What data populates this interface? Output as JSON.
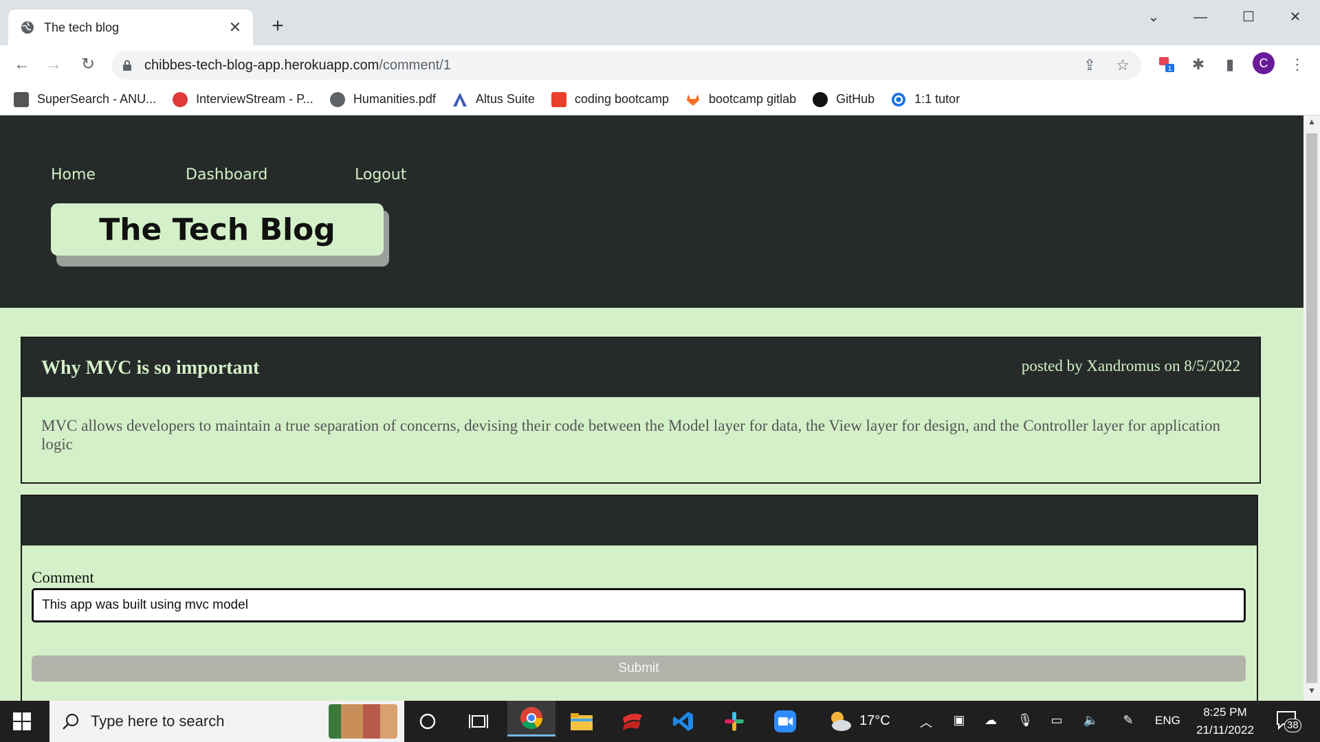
{
  "browser": {
    "tab_title": "The tech blog",
    "url_host": "chibbes-tech-blog-app.herokuapp.com",
    "url_path": "/comment/1",
    "profile_initial": "C",
    "extension_badge": "1"
  },
  "bookmarks": [
    {
      "label": "SuperSearch - ANU...",
      "icon": "supersearch-icon",
      "color": "#555555"
    },
    {
      "label": "InterviewStream - P...",
      "icon": "interviewstream-icon",
      "color": "#e03a3a"
    },
    {
      "label": "Humanities.pdf",
      "icon": "globe-icon",
      "color": "#5f6368"
    },
    {
      "label": "Altus Suite",
      "icon": "altus-icon",
      "color": "#3b5bb5"
    },
    {
      "label": "coding bootcamp",
      "icon": "bootcamp-icon",
      "color": "#e8402a"
    },
    {
      "label": "bootcamp gitlab",
      "icon": "gitlab-icon",
      "color": "#fc6d26"
    },
    {
      "label": "GitHub",
      "icon": "github-icon",
      "color": "#111111"
    },
    {
      "label": "1:1 tutor",
      "icon": "tutor-icon",
      "color": "#1a73e8"
    }
  ],
  "site": {
    "nav": {
      "home": "Home",
      "dashboard": "Dashboard",
      "logout": "Logout"
    },
    "brand": "The Tech Blog"
  },
  "post": {
    "title": "Why MVC is so important",
    "meta": "posted by Xandromus on 8/5/2022",
    "body": "MVC allows developers to maintain a true separation of concerns, devising their code between the Model layer for data, the View layer for design, and the Controller layer for application logic"
  },
  "comment_form": {
    "label": "Comment",
    "value": "This app was built using mvc model",
    "submit_label": "Submit"
  },
  "taskbar": {
    "search_placeholder": "Type here to search",
    "weather": "17°C",
    "language": "ENG",
    "time": "8:25 PM",
    "date": "21/11/2022",
    "notifications": "38"
  },
  "colors": {
    "header_bg": "#262b2a",
    "page_bg": "#d4f0c8",
    "accent_text": "#d4f0c8"
  }
}
